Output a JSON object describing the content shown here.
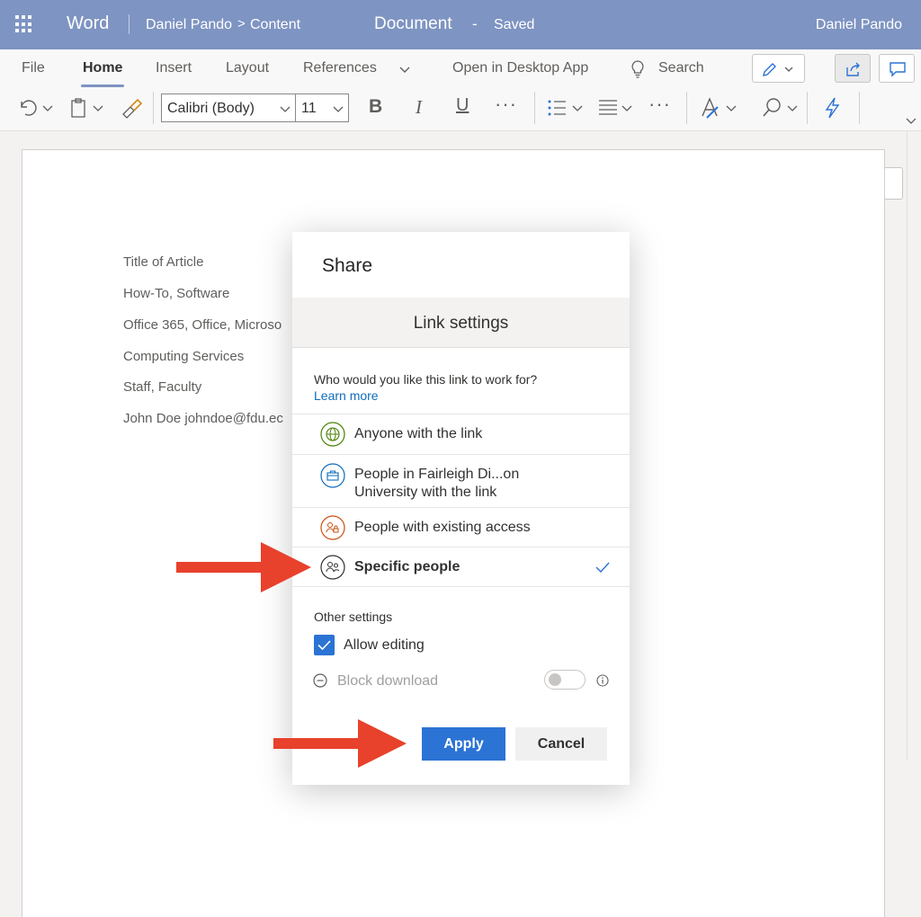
{
  "appbar": {
    "app_name": "Word",
    "breadcrumb_user": "Daniel Pando",
    "breadcrumb_chevron": ">",
    "breadcrumb_folder": "Content",
    "document_title": "Document",
    "title_dash": "-",
    "save_status": "Saved",
    "account_name": "Daniel Pando",
    "background_color": "#7e94c2"
  },
  "ribbon": {
    "tabs": [
      {
        "label": "File"
      },
      {
        "label": "Home",
        "active": true
      },
      {
        "label": "Insert"
      },
      {
        "label": "Layout"
      },
      {
        "label": "References"
      }
    ],
    "open_desktop": "Open in Desktop App",
    "search_label": "Search",
    "font_name": "Calibri (Body)",
    "font_size": "11",
    "bold_label": "B",
    "italic_label": "I",
    "underline_label": "U",
    "more_label": "···",
    "icons": [
      "undo-icon",
      "paste-icon",
      "format-painter-icon",
      "bullets-icon",
      "align-icon",
      "styles-icon",
      "find-icon",
      "lightning-icon",
      "pen-icon",
      "share-icon",
      "comment-icon",
      "lightbulb-icon"
    ]
  },
  "document": {
    "lines": [
      "Title of Article",
      "How-To, Software",
      "Office 365, Office, Microso",
      "Computing Services",
      "Staff, Faculty",
      "John Doe johndoe@fdu.ec"
    ]
  },
  "share_dialog": {
    "title": "Share",
    "subtitle": "Link settings",
    "question": "Who would you like this link to work for?",
    "learn_more": "Learn more",
    "options": [
      {
        "label": "Anyone with the link",
        "icon": "globe-icon",
        "color": "#498205"
      },
      {
        "label_line1": "People in Fairleigh Di...on",
        "label_line2": "University with the link",
        "icon": "briefcase-icon",
        "color": "#0f6cbd"
      },
      {
        "label": "People with existing access",
        "icon": "people-lock-icon",
        "color": "#ca5010"
      },
      {
        "label": "Specific people",
        "icon": "people-icon",
        "color": "#323130",
        "selected": true
      }
    ],
    "other_settings": "Other settings",
    "allow_editing": "Allow editing",
    "allow_editing_checked": true,
    "block_download": "Block download",
    "block_download_on": false,
    "apply": "Apply",
    "cancel": "Cancel",
    "accent_color": "#2b73d4"
  },
  "annotations": {
    "arrow_color": "#e8412c",
    "arrows": [
      "arrow-to-specific-people",
      "arrow-to-apply"
    ]
  }
}
